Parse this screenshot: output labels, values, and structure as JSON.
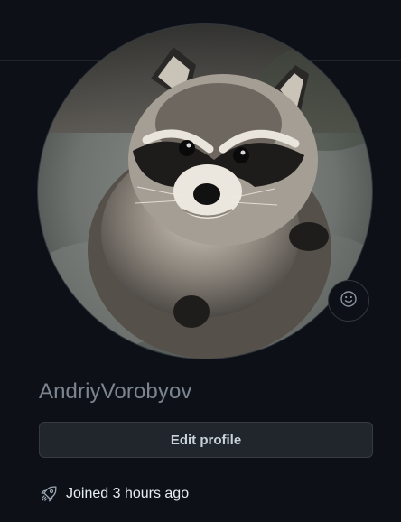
{
  "profile": {
    "username": "AndriyVorobyov",
    "avatar_subject": "raccoon photo",
    "status_icon": "smiley-icon",
    "edit_button_label": "Edit profile",
    "joined_icon": "rocket-icon",
    "joined_text": "Joined 3 hours ago"
  },
  "colors": {
    "background": "#0d1117",
    "divider": "#21262d",
    "username": "#7d8590",
    "button_bg": "#21262d",
    "button_border": "#363b42",
    "text_primary": "#e6edf3"
  }
}
